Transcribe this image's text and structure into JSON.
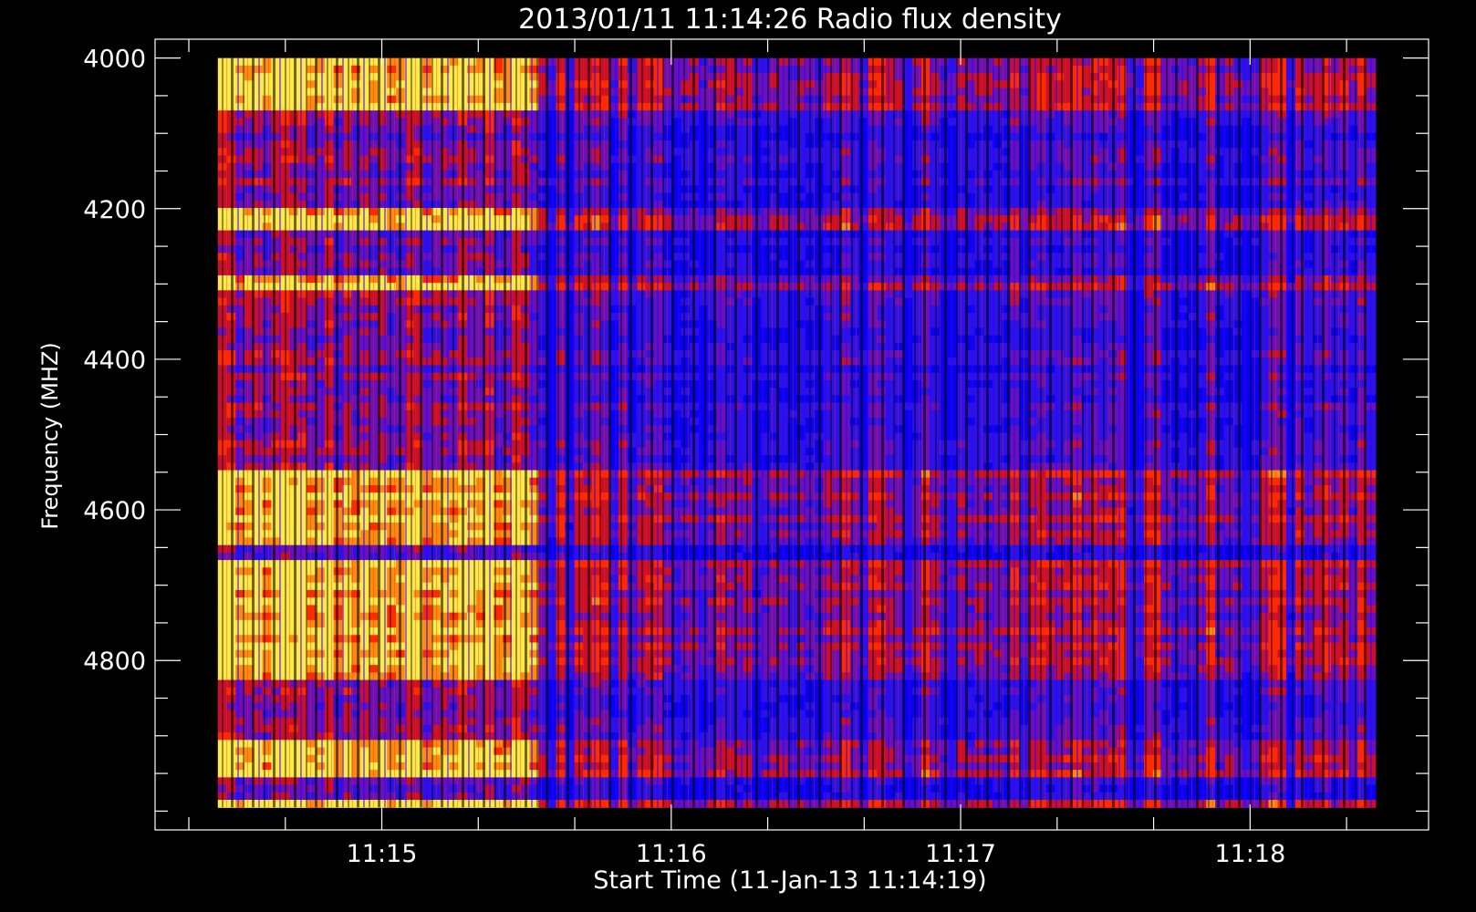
{
  "chart_data": {
    "type": "heatmap",
    "title": "2013/01/11 11:14:26 Radio flux density",
    "xlabel": "Start Time (11-Jan-13 11:14:19)",
    "ylabel": "Frequency (MHZ)",
    "x_ticks": [
      {
        "label": "11:15",
        "t": 41
      },
      {
        "label": "11:16",
        "t": 101
      },
      {
        "label": "11:17",
        "t": 161
      },
      {
        "label": "11:18",
        "t": 221
      }
    ],
    "x_minor_step_seconds": 20,
    "x_range_seconds": [
      -6,
      258
    ],
    "y_ticks": [
      4000,
      4200,
      4400,
      4600,
      4800
    ],
    "y_minor_step": 50,
    "y_range": [
      3975,
      5025
    ],
    "data_extent": {
      "time_start_seconds": 7,
      "time_end_seconds": 247,
      "freq_start": 4000,
      "freq_end": 4995
    },
    "colorscale": [
      "#000000",
      "#0000ff",
      "#8000c0",
      "#ff0000",
      "#ff8000",
      "#ffff00"
    ],
    "intense_time_end_seconds": 73,
    "bright_frequency_bands": [
      [
        4000,
        4060
      ],
      [
        4190,
        4220
      ],
      [
        4280,
        4300
      ],
      [
        4540,
        4640
      ],
      [
        4660,
        4820
      ],
      [
        4900,
        4950
      ],
      [
        4985,
        4995
      ]
    ],
    "grid": false
  }
}
